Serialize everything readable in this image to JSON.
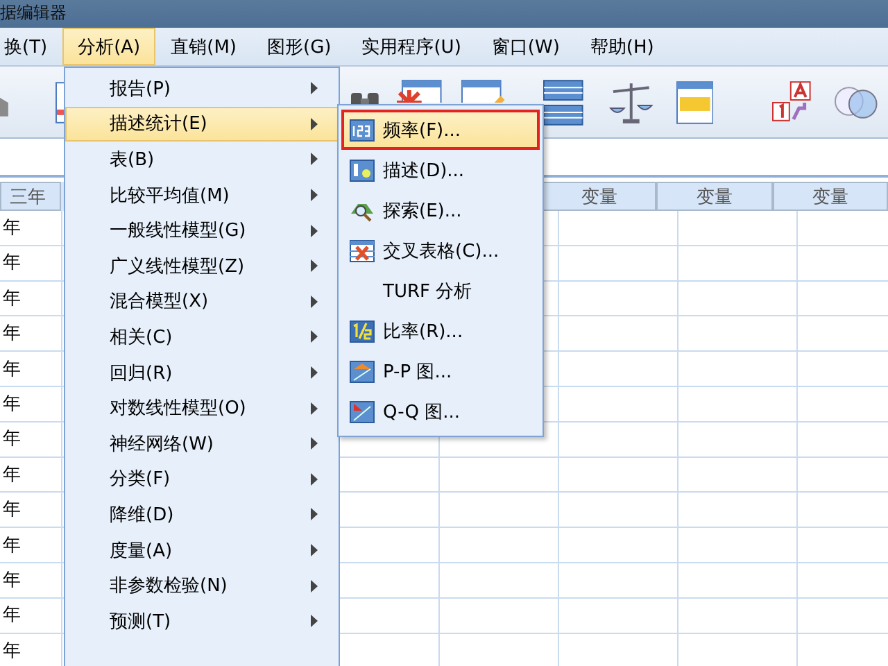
{
  "window": {
    "title": "据编辑器"
  },
  "menu_bar": [
    {
      "label": "换(T)",
      "selected": false
    },
    {
      "label": "分析(A)",
      "selected": true
    },
    {
      "label": "直销(M)",
      "selected": false
    },
    {
      "label": "图形(G)",
      "selected": false
    },
    {
      "label": "实用程序(U)",
      "selected": false
    },
    {
      "label": "窗口(W)",
      "selected": false
    },
    {
      "label": "帮助(H)",
      "selected": false
    }
  ],
  "analyze_menu": [
    {
      "label": "报告(P)",
      "selected": false
    },
    {
      "label": "描述统计(E)",
      "selected": true
    },
    {
      "label": "表(B)",
      "selected": false
    },
    {
      "label": "比较平均值(M)",
      "selected": false
    },
    {
      "label": "一般线性模型(G)",
      "selected": false
    },
    {
      "label": "广义线性模型(Z)",
      "selected": false
    },
    {
      "label": "混合模型(X)",
      "selected": false
    },
    {
      "label": "相关(C)",
      "selected": false
    },
    {
      "label": "回归(R)",
      "selected": false
    },
    {
      "label": "对数线性模型(O)",
      "selected": false
    },
    {
      "label": "神经网络(W)",
      "selected": false
    },
    {
      "label": "分类(F)",
      "selected": false
    },
    {
      "label": "降维(D)",
      "selected": false
    },
    {
      "label": "度量(A)",
      "selected": false
    },
    {
      "label": "非参数检验(N)",
      "selected": false
    },
    {
      "label": "预测(T)",
      "selected": false
    }
  ],
  "descriptive_submenu": [
    {
      "label": "频率(F)...",
      "selected": true
    },
    {
      "label": "描述(D)...",
      "selected": false
    },
    {
      "label": "探索(E)...",
      "selected": false
    },
    {
      "label": "交叉表格(C)...",
      "selected": false
    },
    {
      "label": "TURF 分析",
      "selected": false
    },
    {
      "label": "比率(R)...",
      "selected": false
    },
    {
      "label": "P-P 图...",
      "selected": false
    },
    {
      "label": "Q-Q 图...",
      "selected": false
    }
  ],
  "grid": {
    "first_column": "三年",
    "variable_columns": [
      "变量",
      "变量",
      "变量"
    ],
    "rows": [
      "年",
      "年",
      "年",
      "年",
      "年",
      "年",
      "年",
      "年",
      "年",
      "年",
      "年",
      "年",
      "年"
    ]
  }
}
